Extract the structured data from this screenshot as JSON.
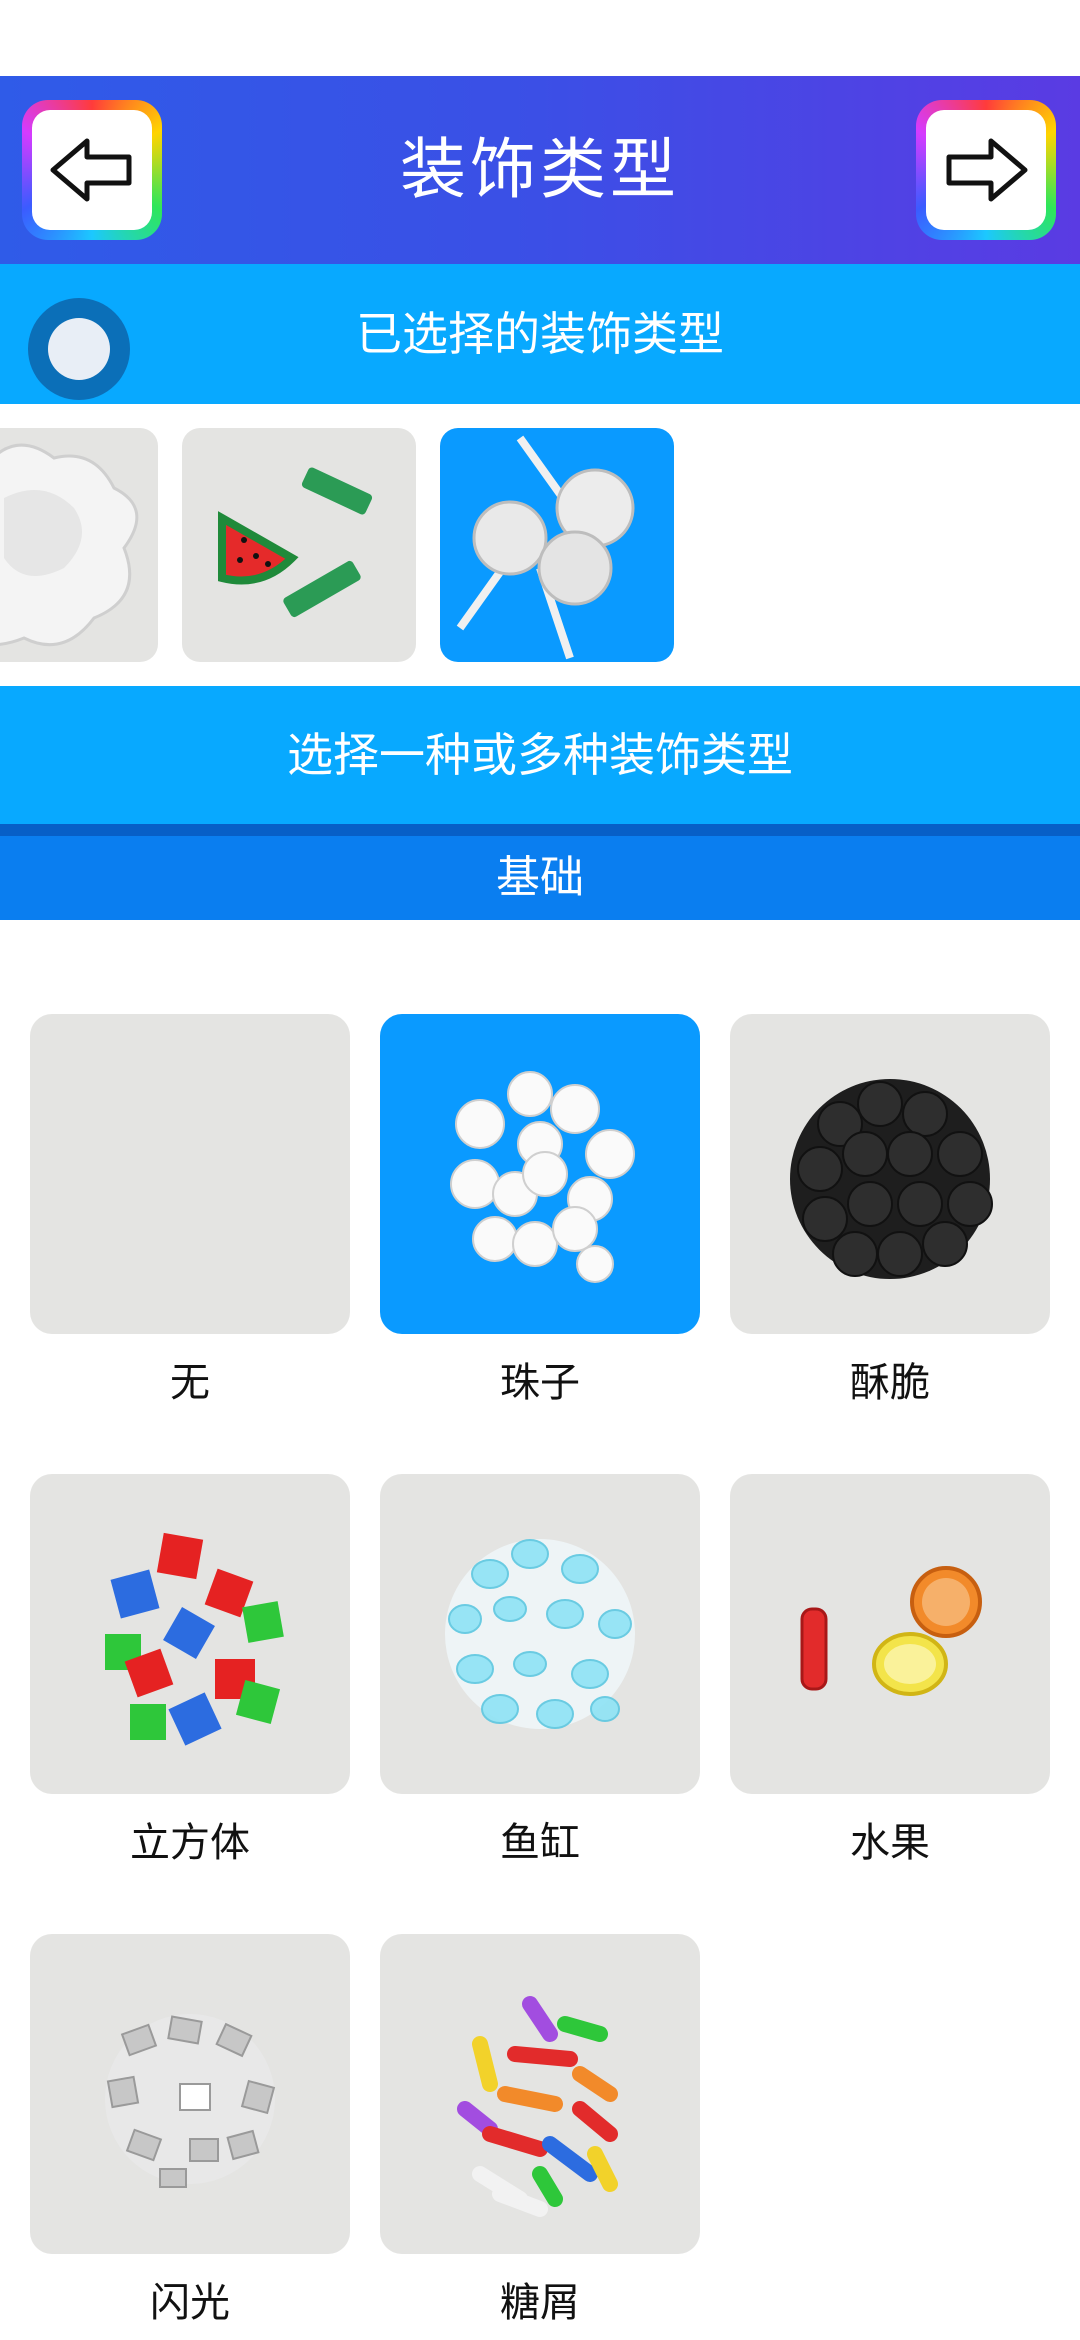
{
  "header": {
    "title": "装饰类型",
    "back_icon": "arrow-left-icon",
    "next_icon": "arrow-right-icon"
  },
  "selected": {
    "label": "已选择的装饰类型",
    "items": [
      "marshmallow",
      "watermelon",
      "lollipop"
    ]
  },
  "choose": {
    "label": "选择一种或多种装饰类型"
  },
  "category": {
    "label": "基础"
  },
  "options": [
    {
      "label": "无",
      "selected": false
    },
    {
      "label": "珠子",
      "selected": true
    },
    {
      "label": "酥脆",
      "selected": false
    },
    {
      "label": "立方体",
      "selected": false
    },
    {
      "label": "鱼缸",
      "selected": false
    },
    {
      "label": "水果",
      "selected": false
    },
    {
      "label": "闪光",
      "selected": false
    },
    {
      "label": "糖屑",
      "selected": false
    }
  ],
  "colors": {
    "accent": "#08a9ff",
    "category": "#0a7ef0",
    "selected_tile": "#0a9aff",
    "tile": "#e4e4e2"
  }
}
